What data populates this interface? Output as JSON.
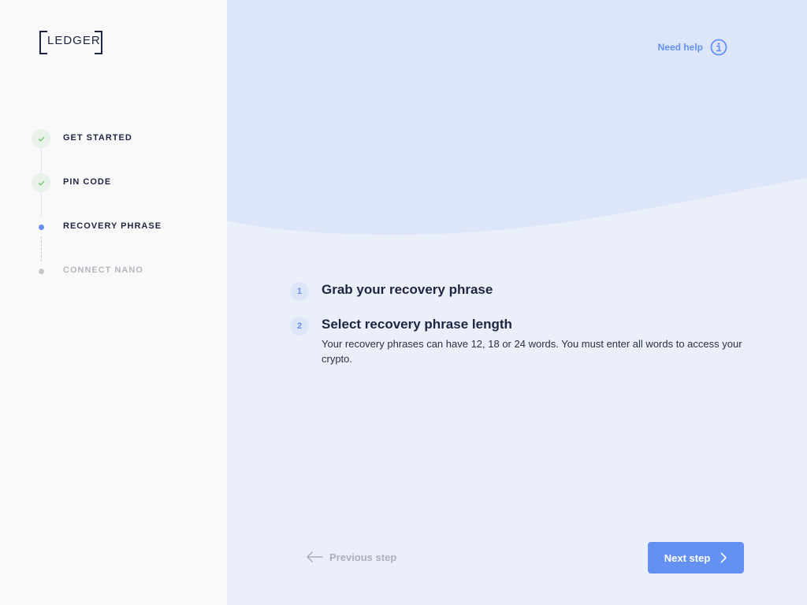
{
  "brand": {
    "logo_text": "LEDGER"
  },
  "sidebar": {
    "steps": [
      {
        "label": "GET STARTED",
        "status": "done"
      },
      {
        "label": "PIN CODE",
        "status": "done"
      },
      {
        "label": "RECOVERY PHRASE",
        "status": "current"
      },
      {
        "label": "CONNECT NANO",
        "status": "upcoming"
      }
    ]
  },
  "header": {
    "help_label": "Need help"
  },
  "main": {
    "instructions": [
      {
        "number": "1",
        "title": "Grab your recovery phrase",
        "description": ""
      },
      {
        "number": "2",
        "title": "Select recovery phrase length",
        "description": "Your recovery phrases can have 12, 18 or 24 words. You must enter all words to access your crypto."
      }
    ]
  },
  "footer": {
    "previous_label": "Previous step",
    "next_label": "Next step"
  },
  "colors": {
    "accent": "#6490f1",
    "done_check": "#6bbf6b",
    "current_dot": "#6490f1",
    "upcoming_dot": "#c4c7cc",
    "text_dark": "#1e2540",
    "text_muted": "#a9afbb",
    "sidebar_bg": "#f9f9f9",
    "main_bg": "#ebeffa",
    "wave_bg": "#dde5f8"
  }
}
